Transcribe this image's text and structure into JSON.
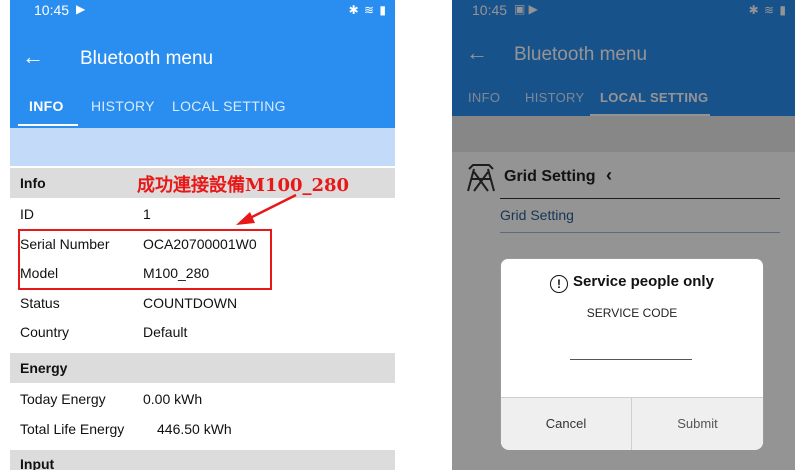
{
  "left": {
    "time": "10:45",
    "status_icons": "▶",
    "app_title": "Bluetooth menu",
    "tabs": [
      "INFO",
      "HISTORY",
      "LOCAL SETTING"
    ],
    "info": {
      "header": "Info",
      "rows": [
        {
          "label": "ID",
          "value": "1"
        },
        {
          "label": "Serial Number",
          "value": "OCA20700001W0"
        },
        {
          "label": "Model",
          "value": "M100_280"
        },
        {
          "label": "Status",
          "value": "COUNTDOWN"
        },
        {
          "label": "Country",
          "value": "Default"
        }
      ]
    },
    "energy": {
      "header": "Energy",
      "rows": [
        {
          "label": "Today Energy",
          "value": "0.00 kWh"
        },
        {
          "label": "Total Life Energy",
          "value": "446.50 kWh"
        }
      ]
    },
    "input_header": "Input",
    "annotation": "成功連接設備M100_280"
  },
  "right": {
    "time": "10:45",
    "status_icons": "▣ ▶",
    "app_title": "Bluetooth menu",
    "tabs": [
      "INFO",
      "HISTORY",
      "LOCAL SETTING"
    ],
    "grid_setting_title": "Grid Setting",
    "grid_setting_item": "Grid Setting",
    "dialog": {
      "title": "Service people only",
      "code_label": "SERVICE CODE",
      "code_value": "",
      "cancel": "Cancel",
      "submit": "Submit"
    }
  },
  "colors": {
    "appbar": "#2a8ef0",
    "highlight": "#e81818"
  }
}
